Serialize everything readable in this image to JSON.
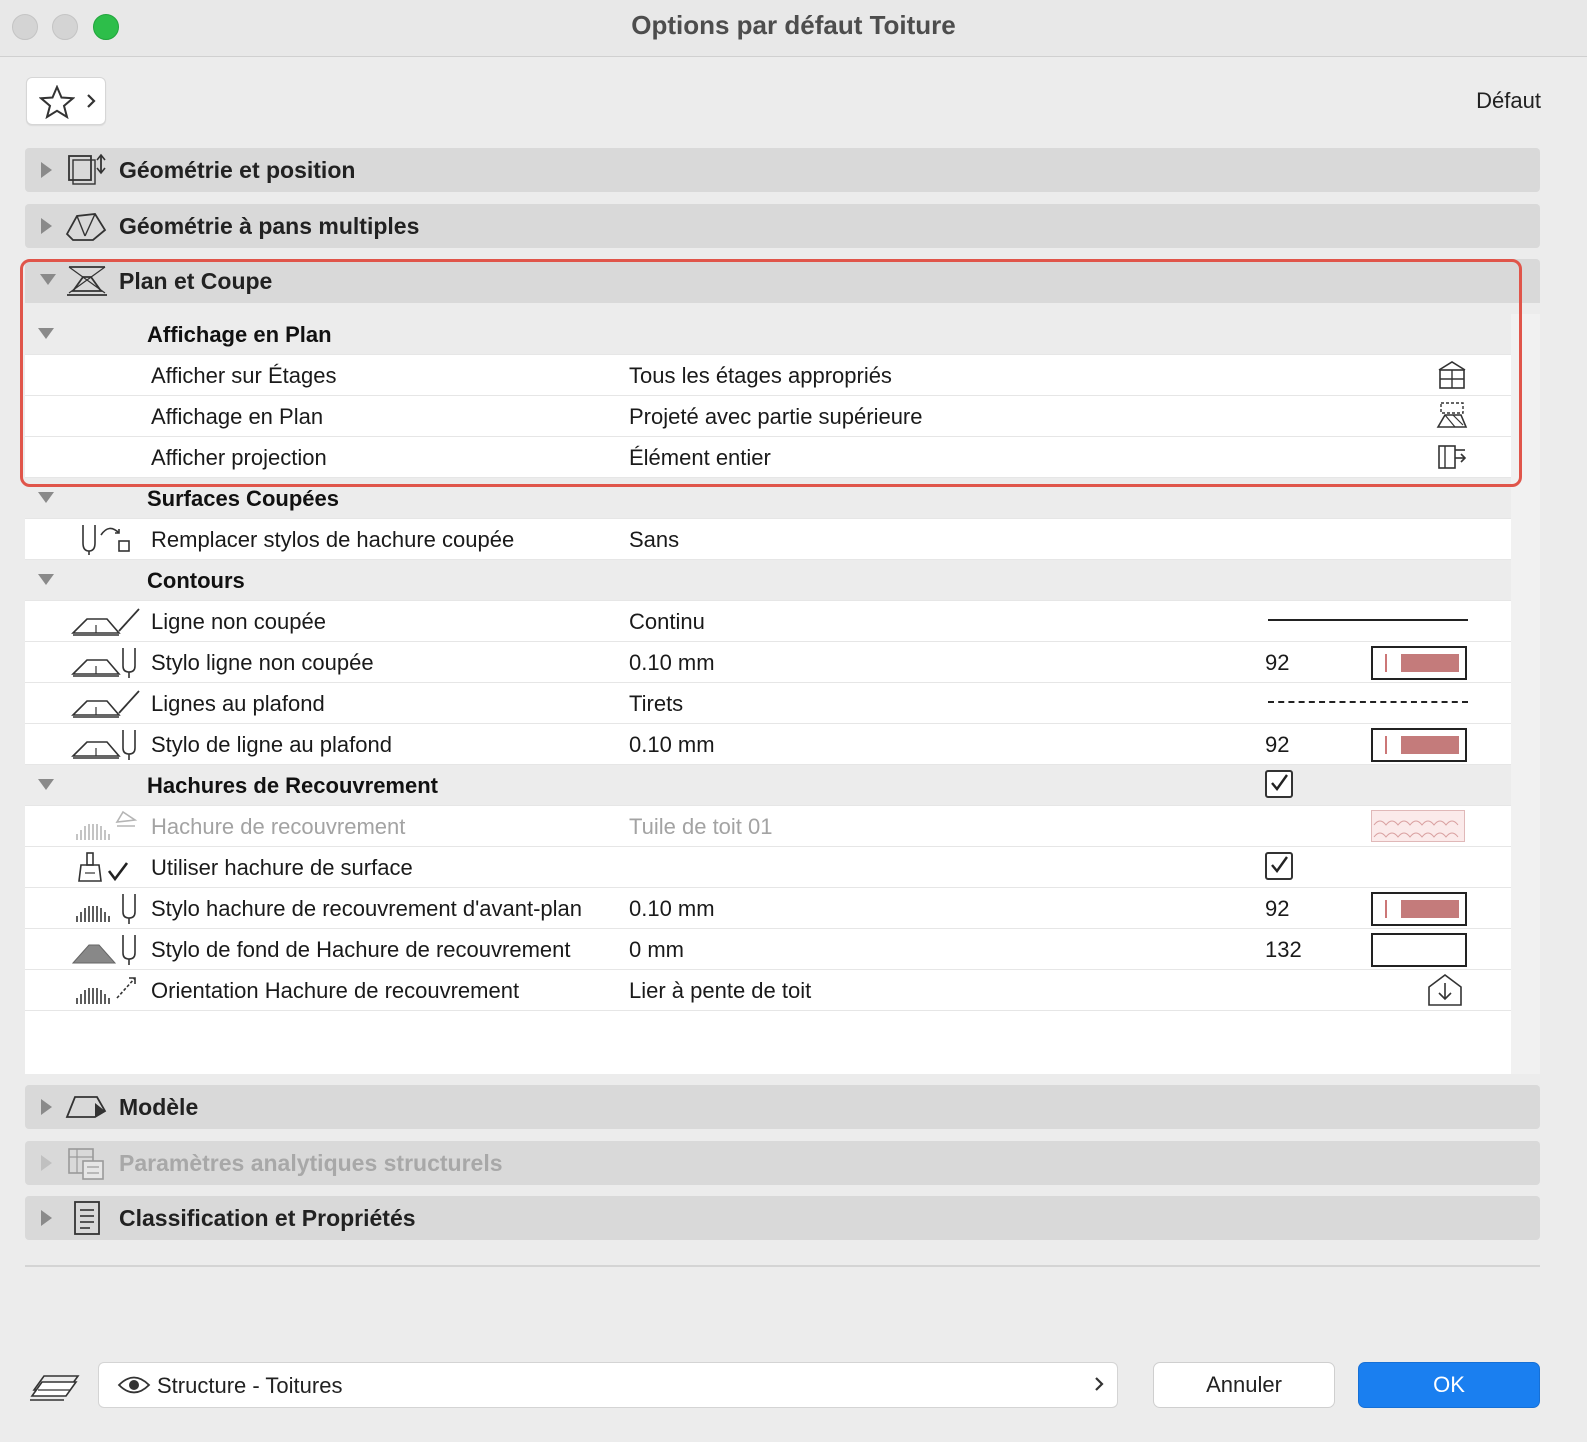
{
  "window": {
    "title": "Options par défaut Toiture"
  },
  "toolbar": {
    "default_label": "Défaut"
  },
  "sections": {
    "geometrie_position": {
      "title": "Géométrie et position"
    },
    "geometrie_pans": {
      "title": "Géométrie à pans multiples"
    },
    "plan_coupe": {
      "title": "Plan et Coupe"
    },
    "modele": {
      "title": "Modèle"
    },
    "analytique": {
      "title": "Paramètres analytiques structurels"
    },
    "classification": {
      "title": "Classification et Propriétés"
    }
  },
  "plan_coupe": {
    "affichage": {
      "title": "Affichage en Plan",
      "rows": [
        {
          "label": "Afficher sur Étages",
          "value": "Tous les étages appropriés"
        },
        {
          "label": "Affichage en Plan",
          "value": "Projeté avec partie supérieure"
        },
        {
          "label": "Afficher projection",
          "value": "Élément entier"
        }
      ]
    },
    "surfaces": {
      "title": "Surfaces Coupées",
      "rows": [
        {
          "label": "Remplacer stylos de hachure coupée",
          "value": "Sans"
        }
      ]
    },
    "contours": {
      "title": "Contours",
      "rows": [
        {
          "label": "Ligne non coupée",
          "value": "Continu"
        },
        {
          "label": "Stylo ligne non coupée",
          "value": "0.10 mm",
          "pen": "92"
        },
        {
          "label": "Lignes au plafond",
          "value": "Tirets"
        },
        {
          "label": "Stylo de ligne au plafond",
          "value": "0.10 mm",
          "pen": "92"
        }
      ]
    },
    "hachures": {
      "title": "Hachures de Recouvrement",
      "checked": true,
      "rows": [
        {
          "label": "Hachure de recouvrement",
          "value": "Tuile de toit 01"
        },
        {
          "label": "Utiliser hachure de surface",
          "value": "",
          "checked": true
        },
        {
          "label": "Stylo hachure de recouvrement d'avant-plan",
          "value": "0.10 mm",
          "pen": "92"
        },
        {
          "label": "Stylo de fond de Hachure de recouvrement",
          "value": "0 mm",
          "pen": "132"
        },
        {
          "label": "Orientation Hachure de recouvrement",
          "value": "Lier à pente de toit"
        }
      ]
    }
  },
  "footer": {
    "layer": "Structure - Toitures",
    "cancel_label": "Annuler",
    "ok_label": "OK"
  },
  "colors": {
    "pen_swatch": "#c47b7b",
    "highlight": "#e0554a",
    "ok_button": "#1a7ff0"
  }
}
